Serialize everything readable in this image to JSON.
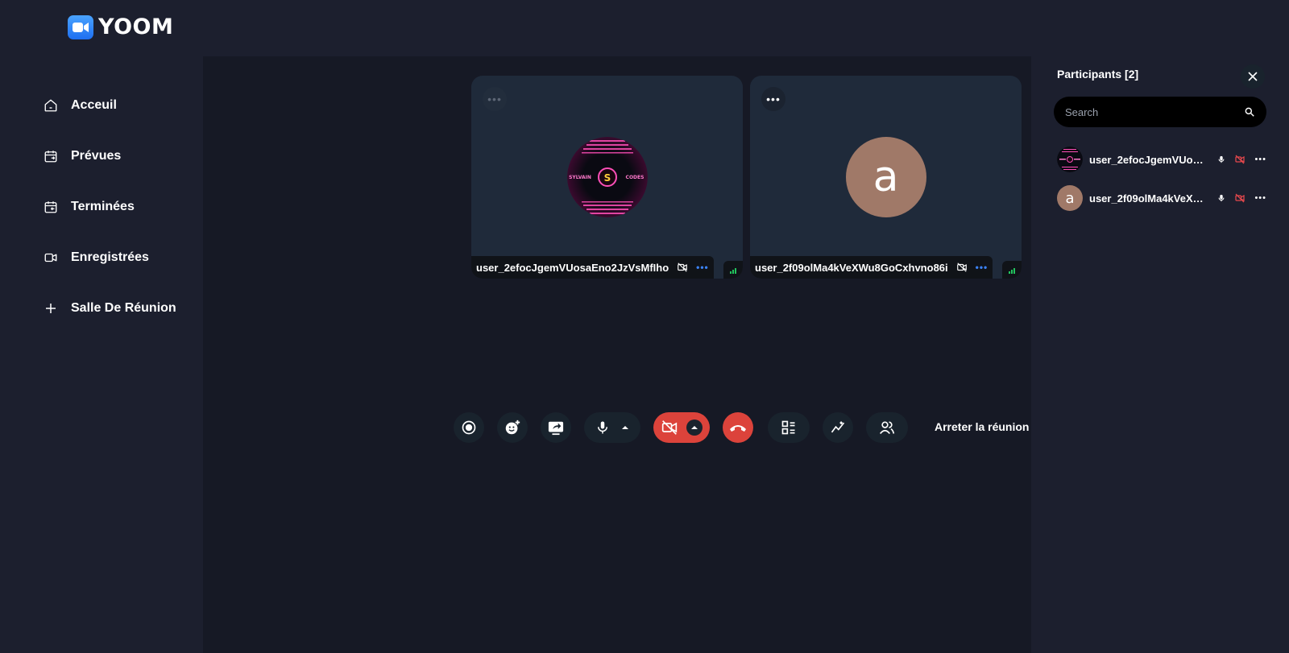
{
  "app": {
    "name": "YOOM"
  },
  "sidebar": {
    "items": [
      {
        "label": "Acceuil",
        "icon": "home-icon"
      },
      {
        "label": "Prévues",
        "icon": "calendar-upcoming-icon"
      },
      {
        "label": "Terminées",
        "icon": "calendar-previous-icon"
      },
      {
        "label": "Enregistrées",
        "icon": "video-icon"
      },
      {
        "label": "Salle De Réunion",
        "icon": "plus-icon"
      }
    ]
  },
  "tiles": [
    {
      "name": "user_2efocJgemVUosaEno2JzVsMfIho",
      "avatar_text": {
        "left": "SYLVAIN",
        "right": "CODES"
      },
      "menu_icon": "more-icon"
    },
    {
      "name": "user_2f09olMa4kVeXWu8GoCxhvno86i",
      "avatar_letter": "a",
      "menu_icon": "more-icon"
    }
  ],
  "controls": {
    "end_meeting_label": "Arreter la réunion",
    "buttons": [
      "record-icon",
      "reaction-icon",
      "screen-share-icon",
      "microphone-icon",
      "camera-off-icon",
      "hang-up-icon",
      "layout-icon",
      "stats-icon",
      "participants-icon"
    ]
  },
  "participants": {
    "title": "Participants [2]",
    "search_placeholder": "Search",
    "list": [
      {
        "name": "user_2efocJgemVUosa...",
        "avatar_letter": ""
      },
      {
        "name": "user_2f09olMa4kVeXW...",
        "avatar_letter": "a"
      }
    ]
  },
  "colors": {
    "background": "#1c1f2e",
    "stage": "#161925",
    "tile": "#1f2a3a",
    "danger": "#dc433b",
    "accent": "#3b82f6",
    "signal": "#22c55e",
    "avatar_letter_bg": "#a07968"
  }
}
